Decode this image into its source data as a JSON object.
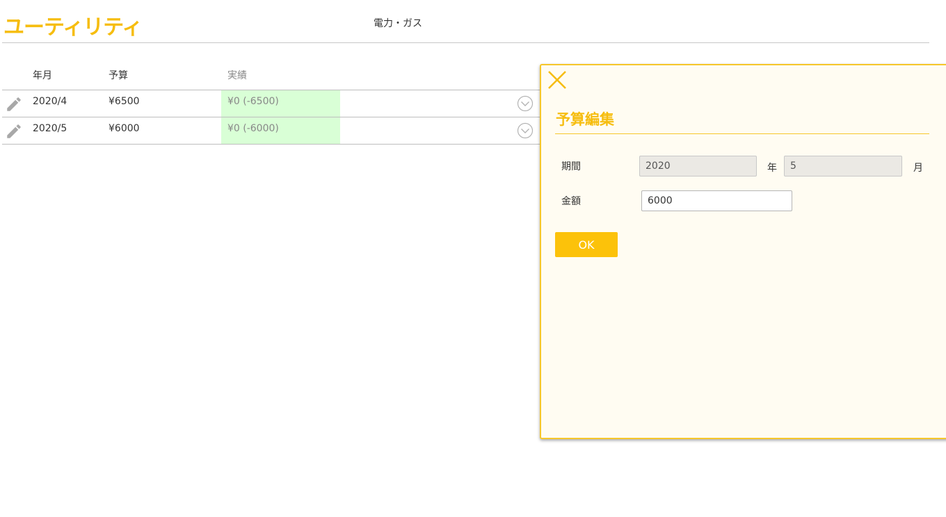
{
  "header": {
    "title": "ユーティリティ",
    "subtitle": "電力・ガス"
  },
  "table": {
    "columns": {
      "month": "年月",
      "budget": "予算",
      "actual": "実績"
    },
    "rows": [
      {
        "month": "2020/4",
        "budget": "¥6500",
        "actual": "¥0 (-6500)"
      },
      {
        "month": "2020/5",
        "budget": "¥6000",
        "actual": "¥0 (-6000)"
      }
    ]
  },
  "panel": {
    "title": "予算編集",
    "period_label": "期間",
    "year_value": "2020",
    "year_unit": "年",
    "month_value": "5",
    "month_unit": "月",
    "amount_label": "金額",
    "amount_value": "6000",
    "ok_label": "OK"
  },
  "icons": {
    "edit": "pencil-icon",
    "expand": "chevron-down-circle-icon",
    "close": "close-icon"
  },
  "colors": {
    "accent": "#f6bd0f",
    "actual_bg": "#d9ffd6",
    "panel_bg": "#fffcf2",
    "ok_button": "#fcc20a"
  }
}
